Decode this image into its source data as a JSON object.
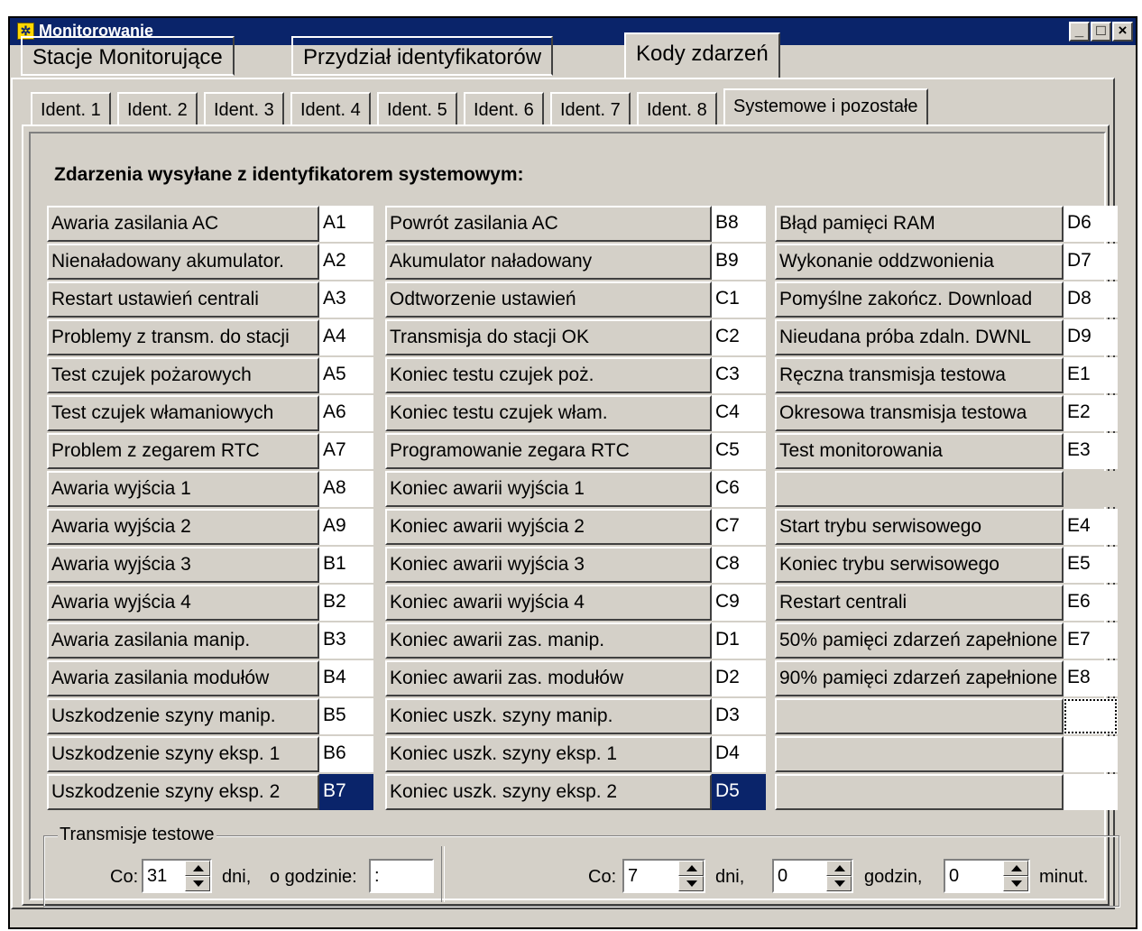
{
  "window": {
    "title": "Monitorowanie",
    "controls": {
      "minimize": "_",
      "maximize": "□",
      "close": "×"
    }
  },
  "main_tabs": [
    {
      "label": "Stacje Monitorujące",
      "active": false
    },
    {
      "label": "Przydział identyfikatorów",
      "active": false
    },
    {
      "label": "Kody zdarzeń",
      "active": true
    }
  ],
  "sub_tabs": [
    {
      "label": "Ident. 1",
      "active": false
    },
    {
      "label": "Ident. 2",
      "active": false
    },
    {
      "label": "Ident. 3",
      "active": false
    },
    {
      "label": "Ident. 4",
      "active": false
    },
    {
      "label": "Ident. 5",
      "active": false
    },
    {
      "label": "Ident. 6",
      "active": false
    },
    {
      "label": "Ident. 7",
      "active": false
    },
    {
      "label": "Ident. 8",
      "active": false
    },
    {
      "label": "Systemowe i pozostałe",
      "active": true
    }
  ],
  "section_title": "Zdarzenia wysyłane z identyfikatorem systemowym:",
  "columns": [
    {
      "rows": [
        {
          "label": "Awaria zasilania AC",
          "code": "A1"
        },
        {
          "label": "Nienaładowany akumulator.",
          "code": "A2"
        },
        {
          "label": "Restart ustawień centrali",
          "code": "A3"
        },
        {
          "label": "Problemy z transm. do stacji",
          "code": "A4"
        },
        {
          "label": "Test czujek pożarowych",
          "code": "A5"
        },
        {
          "label": "Test czujek włamaniowych",
          "code": "A6"
        },
        {
          "label": "Problem z zegarem RTC",
          "code": "A7"
        },
        {
          "label": "Awaria wyjścia 1",
          "code": "A8"
        },
        {
          "label": "Awaria wyjścia 2",
          "code": "A9"
        },
        {
          "label": "Awaria wyjścia 3",
          "code": "B1"
        },
        {
          "label": "Awaria wyjścia 4",
          "code": "B2"
        },
        {
          "label": "Awaria zasilania manip.",
          "code": "B3"
        },
        {
          "label": "Awaria zasilania modułów",
          "code": "B4"
        },
        {
          "label": "Uszkodzenie szyny manip.",
          "code": "B5"
        },
        {
          "label": "Uszkodzenie szyny eksp. 1",
          "code": "B6"
        },
        {
          "label": "Uszkodzenie szyny eksp. 2",
          "code": "B7",
          "state": "selected"
        }
      ]
    },
    {
      "rows": [
        {
          "label": "Powrót zasilania AC",
          "code": "B8"
        },
        {
          "label": "Akumulator naładowany",
          "code": "B9"
        },
        {
          "label": "Odtworzenie ustawień",
          "code": "C1"
        },
        {
          "label": "Transmisja do stacji OK",
          "code": "C2"
        },
        {
          "label": "Koniec testu czujek poż.",
          "code": "C3"
        },
        {
          "label": "Koniec testu czujek włam.",
          "code": "C4"
        },
        {
          "label": "Programowanie zegara RTC",
          "code": "C5"
        },
        {
          "label": "Koniec awarii wyjścia 1",
          "code": "C6"
        },
        {
          "label": "Koniec awarii wyjścia 2",
          "code": "C7"
        },
        {
          "label": "Koniec awarii wyjścia 3",
          "code": "C8"
        },
        {
          "label": "Koniec awarii wyjścia 4",
          "code": "C9"
        },
        {
          "label": "Koniec awarii zas. manip.",
          "code": "D1"
        },
        {
          "label": "Koniec awarii zas. modułów",
          "code": "D2"
        },
        {
          "label": "Koniec uszk. szyny manip.",
          "code": "D3"
        },
        {
          "label": "Koniec uszk. szyny eksp. 1",
          "code": "D4"
        },
        {
          "label": "Koniec uszk. szyny eksp. 2",
          "code": "D5",
          "state": "selected"
        }
      ]
    },
    {
      "rows": [
        {
          "label": "Błąd pamięci RAM",
          "code": "D6"
        },
        {
          "label": "Wykonanie oddzwonienia",
          "code": "D7"
        },
        {
          "label": "Pomyślne zakończ. Download",
          "code": "D8"
        },
        {
          "label": "Nieudana próba zdaln. DWNL",
          "code": "D9"
        },
        {
          "label": "Ręczna transmisja testowa",
          "code": "E1"
        },
        {
          "label": "Okresowa transmisja testowa",
          "code": "E2"
        },
        {
          "label": "Test monitorowania",
          "code": "E3"
        },
        {
          "label": "",
          "code": "",
          "state": "disabled"
        },
        {
          "label": "Start trybu serwisowego",
          "code": "E4"
        },
        {
          "label": "Koniec trybu serwisowego",
          "code": "E5"
        },
        {
          "label": "Restart centrali",
          "code": "E6"
        },
        {
          "label": "50% pamięci zdarzeń zapełnione",
          "code": "E7"
        },
        {
          "label": "90% pamięci zdarzeń zapełnione",
          "code": "E8"
        },
        {
          "label": "",
          "code": "",
          "state": "focused"
        },
        {
          "label": "",
          "code": ""
        },
        {
          "label": "",
          "code": ""
        }
      ]
    }
  ],
  "test_transmissions": {
    "legend": "Transmisje testowe",
    "left": {
      "co_label": "Co:",
      "days_value": "31",
      "days_label": "dni,",
      "time_label": "o godzinie:",
      "time_value": " :"
    },
    "right": {
      "co_label": "Co:",
      "days_value": "7",
      "days_label": "dni,",
      "hours_value": "0",
      "hours_label": "godzin,",
      "minutes_value": "0",
      "minutes_label": "minut."
    }
  }
}
